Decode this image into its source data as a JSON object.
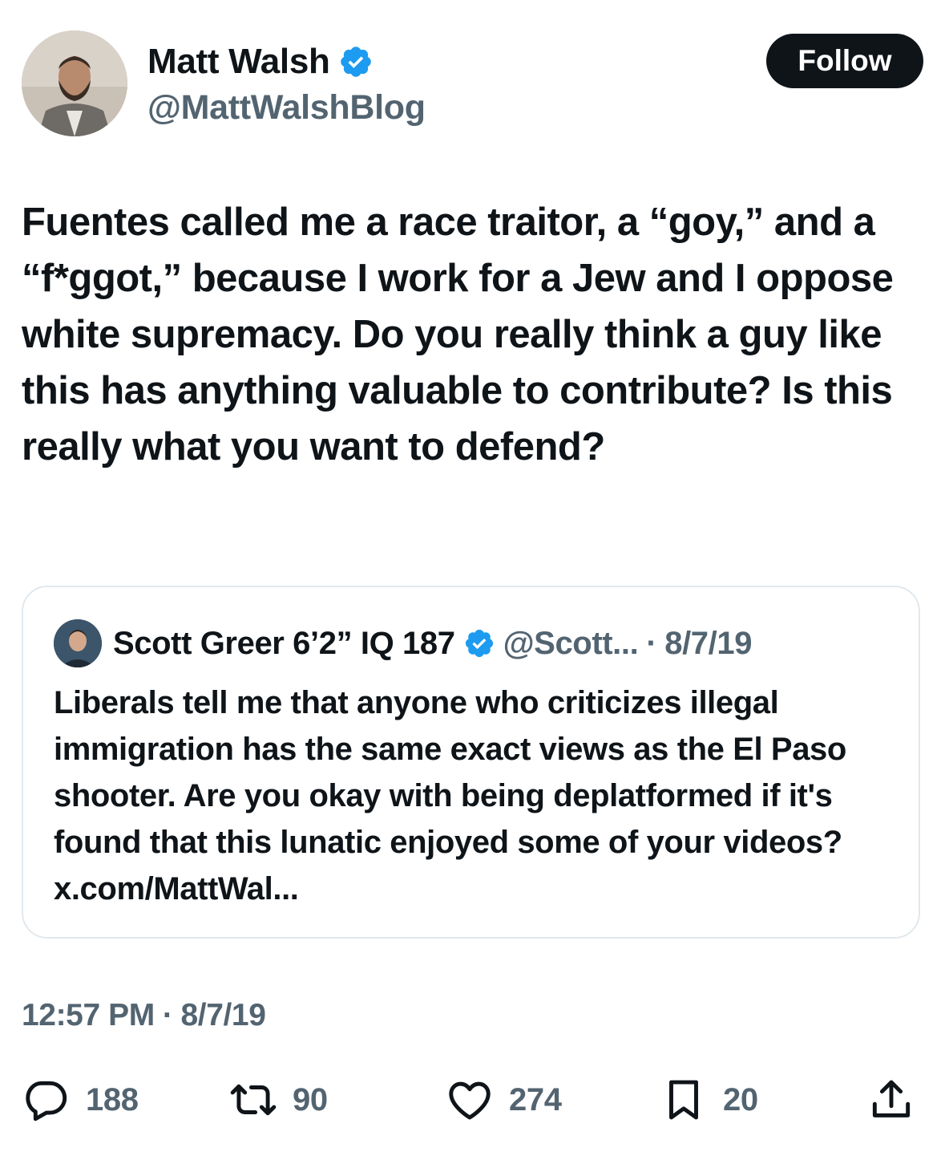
{
  "author": {
    "display_name": "Matt Walsh",
    "handle": "@MattWalshBlog",
    "verified": true,
    "verified_color": "#1d9bf0"
  },
  "follow_button": {
    "label": "Follow"
  },
  "tweet": {
    "text": "Fuentes called me a race traitor, a “goy,” and a “f*ggot,” because I work for a Jew and I oppose white supremacy. Do you really think a guy like this has anything valuable to contribute? Is this really what you want to defend?"
  },
  "quoted_tweet": {
    "display_name": "Scott Greer 6’2” IQ 187",
    "handle": "@Scott...",
    "separator": "·",
    "date": "8/7/19",
    "verified": true,
    "text": "Liberals tell me that anyone who criticizes illegal immigration has the same exact views as the El Paso shooter. Are you okay with being deplatformed if it's found that this lunatic enjoyed some of your videos? x.com/MattWal..."
  },
  "timestamp": {
    "time": "12:57 PM",
    "separator": "·",
    "date": "8/7/19"
  },
  "actions": {
    "replies": {
      "icon": "reply-icon",
      "count": "188"
    },
    "reposts": {
      "icon": "repost-icon",
      "count": "90"
    },
    "likes": {
      "icon": "heart-icon",
      "count": "274"
    },
    "bookmarks": {
      "icon": "bookmark-icon",
      "count": "20"
    },
    "share": {
      "icon": "share-icon"
    }
  },
  "colors": {
    "text_primary": "#0f1419",
    "text_secondary": "#536471",
    "border": "#e1e8ed",
    "follow_bg": "#0f1419"
  }
}
